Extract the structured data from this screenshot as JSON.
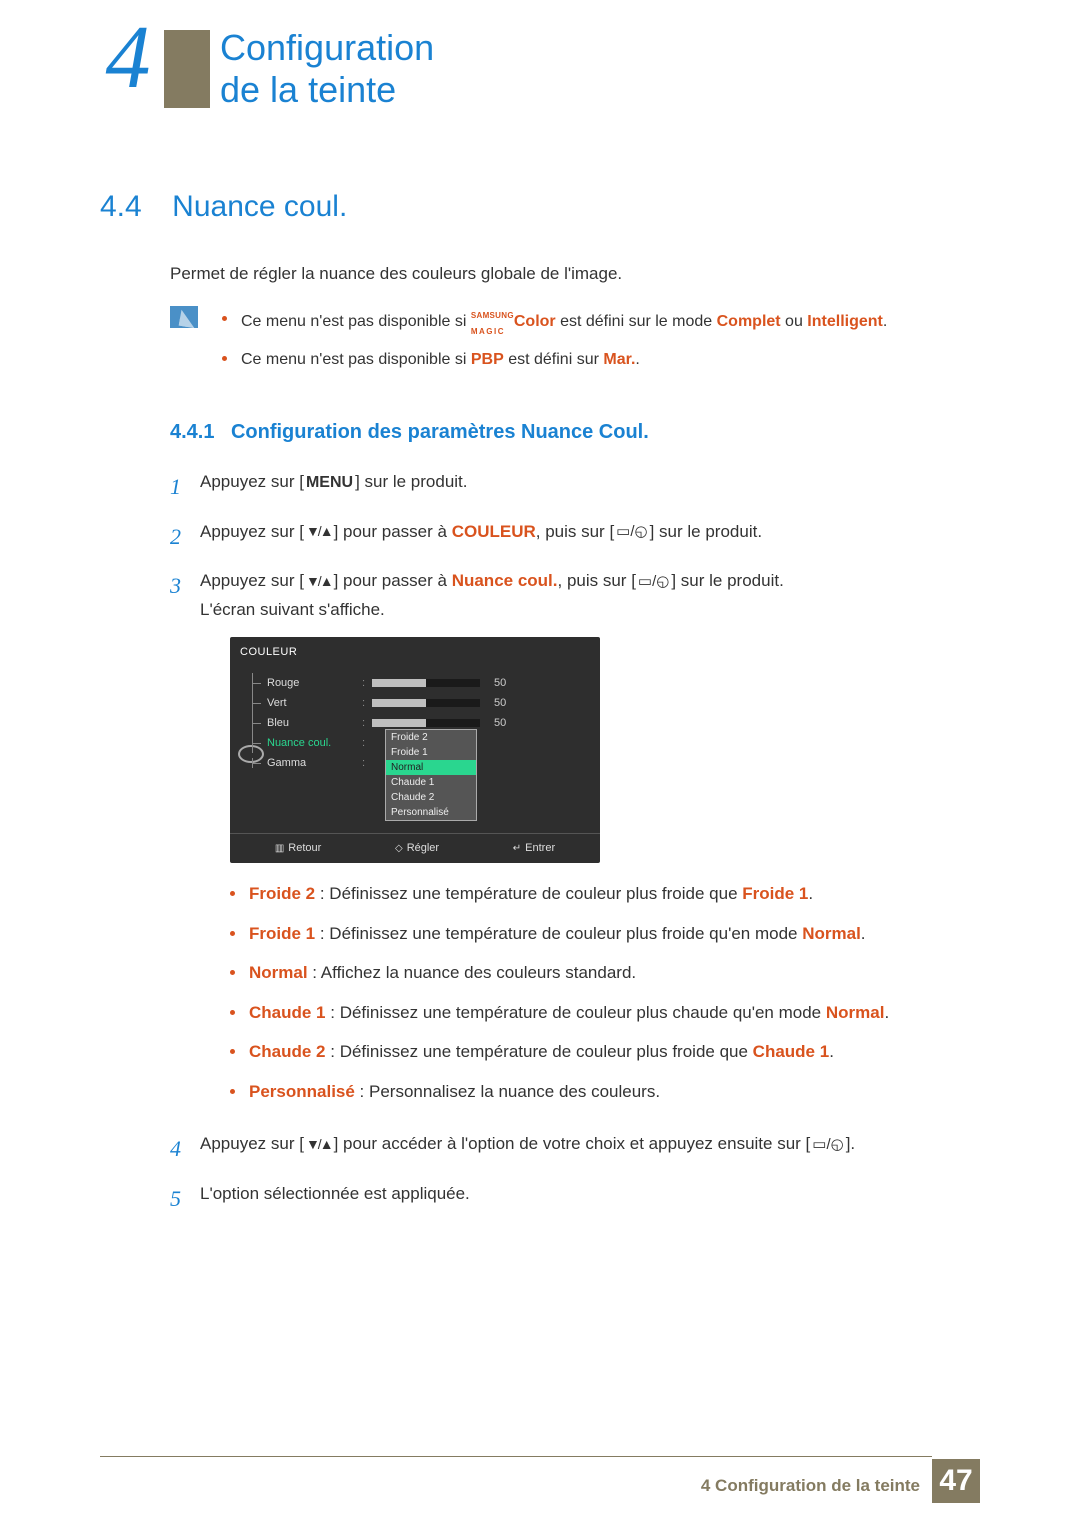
{
  "header": {
    "chapter_number": "4",
    "title": "Configuration de la teinte"
  },
  "section": {
    "number": "4.4",
    "title": "Nuance coul.",
    "intro": "Permet de régler la nuance des couleurs globale de l'image."
  },
  "notes": {
    "n1_pre": "Ce menu n'est pas disponible si ",
    "n1_magic_top": "SAMSUNG",
    "n1_magic_bot": "MAGIC",
    "n1_color": "Color",
    "n1_mid": " est défini sur le mode ",
    "n1_complet": "Complet",
    "n1_ou": " ou ",
    "n1_intelligent": "Intelligent",
    "n1_end": ".",
    "n2_pre": "Ce menu n'est pas disponible si ",
    "n2_pbp": "PBP",
    "n2_mid": " est défini sur ",
    "n2_mar": "Mar.",
    "n2_end": "."
  },
  "subsection": {
    "number": "4.4.1",
    "title": "Configuration des paramètres Nuance Coul."
  },
  "steps": {
    "s1_pre": "Appuyez sur [",
    "s1_menu": "MENU",
    "s1_post": "] sur le produit.",
    "s2_pre": "Appuyez sur [",
    "arrows": "▼/▲",
    "s2_mid1": "] pour passer à ",
    "s2_couleur": "COULEUR",
    "s2_mid2": ", puis sur [",
    "enter_glyph": "▭/◵",
    "s2_end": "] sur le produit.",
    "s3_pre": "Appuyez sur [",
    "s3_mid1": "] pour passer à ",
    "s3_nuance": "Nuance coul.",
    "s3_mid2": ", puis sur [",
    "s3_end": "] sur le produit.",
    "s3_line2": "L'écran suivant s'affiche.",
    "s4_pre": "Appuyez sur [",
    "s4_mid1": "] pour accéder à l'option de votre choix et appuyez ensuite sur [",
    "s4_end": "].",
    "s5": "L'option sélectionnée est appliquée."
  },
  "osd": {
    "title": "COULEUR",
    "rows": {
      "rouge": "Rouge",
      "vert": "Vert",
      "bleu": "Bleu",
      "nuance": "Nuance coul.",
      "gamma": "Gamma"
    },
    "val50": "50",
    "dropdown": [
      "Froide 2",
      "Froide 1",
      "Normal",
      "Chaude 1",
      "Chaude 2",
      "Personnalisé"
    ],
    "footer": {
      "retour": "Retour",
      "regler": "Régler",
      "entrer": "Entrer"
    }
  },
  "options": {
    "froide2_t": "Froide 2",
    "froide2_d": " : Définissez une température de couleur plus froide que ",
    "froide2_ref": "Froide 1",
    "froide1_t": "Froide 1",
    "froide1_d": " : Définissez une température de couleur plus froide qu'en mode ",
    "froide1_ref": "Normal",
    "normal_t": "Normal",
    "normal_d": " : Affichez la nuance des couleurs standard.",
    "chaude1_t": "Chaude 1",
    "chaude1_d": " : Définissez une température de couleur plus chaude qu'en mode ",
    "chaude1_ref": "Normal",
    "chaude2_t": "Chaude 2",
    "chaude2_d": " : Définissez une température de couleur plus froide que ",
    "chaude2_ref": "Chaude 1",
    "perso_t": "Personnalisé",
    "perso_d": " : Personnalisez la nuance des couleurs.",
    "period": "."
  },
  "footer": {
    "text": "4 Configuration de la teinte",
    "page": "47"
  }
}
